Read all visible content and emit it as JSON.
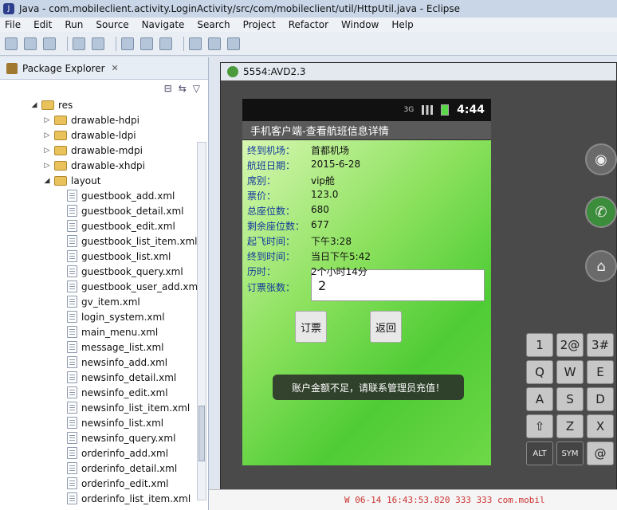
{
  "window": {
    "title": "Java - com.mobileclient.activity.LoginActivity/src/com/mobileclient/util/HttpUtil.java - Eclipse"
  },
  "menu": [
    "File",
    "Edit",
    "Run",
    "Source",
    "Navigate",
    "Search",
    "Project",
    "Refactor",
    "Window",
    "Help"
  ],
  "explorer": {
    "title": "Package Explorer",
    "tree": [
      {
        "label": "res",
        "type": "folder",
        "level": 0,
        "open": true
      },
      {
        "label": "drawable-hdpi",
        "type": "folder",
        "level": 1,
        "open": false
      },
      {
        "label": "drawable-ldpi",
        "type": "folder",
        "level": 1,
        "open": false
      },
      {
        "label": "drawable-mdpi",
        "type": "folder",
        "level": 1,
        "open": false
      },
      {
        "label": "drawable-xhdpi",
        "type": "folder",
        "level": 1,
        "open": false
      },
      {
        "label": "layout",
        "type": "folder",
        "level": 1,
        "open": true
      },
      {
        "label": "guestbook_add.xml",
        "type": "file",
        "level": 2
      },
      {
        "label": "guestbook_detail.xml",
        "type": "file",
        "level": 2
      },
      {
        "label": "guestbook_edit.xml",
        "type": "file",
        "level": 2
      },
      {
        "label": "guestbook_list_item.xml",
        "type": "file",
        "level": 2
      },
      {
        "label": "guestbook_list.xml",
        "type": "file",
        "level": 2
      },
      {
        "label": "guestbook_query.xml",
        "type": "file",
        "level": 2
      },
      {
        "label": "guestbook_user_add.xm",
        "type": "file",
        "level": 2
      },
      {
        "label": "gv_item.xml",
        "type": "file",
        "level": 2
      },
      {
        "label": "login_system.xml",
        "type": "file",
        "level": 2
      },
      {
        "label": "main_menu.xml",
        "type": "file",
        "level": 2
      },
      {
        "label": "message_list.xml",
        "type": "file",
        "level": 2
      },
      {
        "label": "newsinfo_add.xml",
        "type": "file",
        "level": 2
      },
      {
        "label": "newsinfo_detail.xml",
        "type": "file",
        "level": 2
      },
      {
        "label": "newsinfo_edit.xml",
        "type": "file",
        "level": 2
      },
      {
        "label": "newsinfo_list_item.xml",
        "type": "file",
        "level": 2
      },
      {
        "label": "newsinfo_list.xml",
        "type": "file",
        "level": 2
      },
      {
        "label": "newsinfo_query.xml",
        "type": "file",
        "level": 2
      },
      {
        "label": "orderinfo_add.xml",
        "type": "file",
        "level": 2
      },
      {
        "label": "orderinfo_detail.xml",
        "type": "file",
        "level": 2
      },
      {
        "label": "orderinfo_edit.xml",
        "type": "file",
        "level": 2
      },
      {
        "label": "orderinfo_list_item.xml",
        "type": "file",
        "level": 2
      }
    ]
  },
  "emulator": {
    "title": "5554:AVD2.3",
    "status": {
      "time": "4:44",
      "network": "3G"
    },
    "app_title": "手机客户端-查看航班信息详情",
    "details": [
      {
        "label": "终到机场：",
        "value": "首都机场"
      },
      {
        "label": "航班日期：",
        "value": "2015-6-28"
      },
      {
        "label": "席别：",
        "value": "vip舱"
      },
      {
        "label": "票价：",
        "value": "123.0"
      },
      {
        "label": "总座位数：",
        "value": "680"
      },
      {
        "label": "剩余座位数：",
        "value": "677"
      },
      {
        "label": "起飞时间：",
        "value": "下午3:28"
      },
      {
        "label": "终到时间：",
        "value": "当日下午5:42"
      },
      {
        "label": "历时：",
        "value": "2个小时14分"
      }
    ],
    "ticket_label": "订票张数：",
    "ticket_value": "2",
    "btn_order": "订票",
    "btn_back": "返回",
    "toast": "账户金额不足，请联系管理员充值！",
    "keys": [
      {
        "label": "1",
        "row": 0,
        "col": 0
      },
      {
        "label": "2@",
        "row": 0,
        "col": 1
      },
      {
        "label": "3#",
        "row": 0,
        "col": 2
      },
      {
        "label": "Q",
        "row": 1,
        "col": 0
      },
      {
        "label": "W",
        "row": 1,
        "col": 1
      },
      {
        "label": "E",
        "row": 1,
        "col": 2
      },
      {
        "label": "A",
        "row": 2,
        "col": 0
      },
      {
        "label": "S",
        "row": 2,
        "col": 1
      },
      {
        "label": "D",
        "row": 2,
        "col": 2
      },
      {
        "label": "⇧",
        "row": 3,
        "col": 0
      },
      {
        "label": "Z",
        "row": 3,
        "col": 1
      },
      {
        "label": "X",
        "row": 3,
        "col": 2
      },
      {
        "label": "ALT",
        "row": 4,
        "col": 0
      },
      {
        "label": "SYM",
        "row": 4,
        "col": 1
      },
      {
        "label": "@",
        "row": 4,
        "col": 2
      }
    ]
  },
  "console": {
    "text": "W   06-14 16:43:53.820   333   333   com.mobil"
  }
}
